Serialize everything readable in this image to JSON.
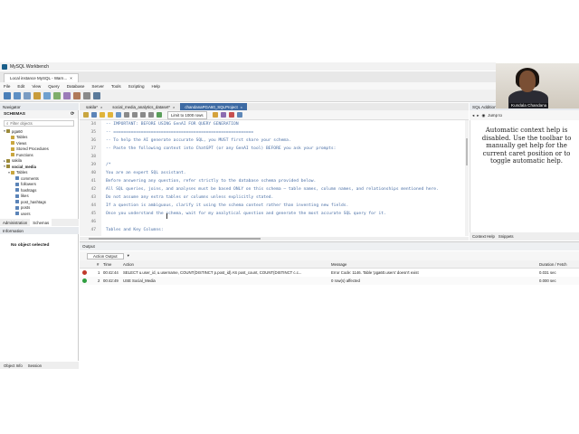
{
  "window": {
    "title": "MySQL Workbench"
  },
  "connection_tabs": [
    {
      "label": "Local instance MySQL - Warn..."
    }
  ],
  "menu": [
    "File",
    "Edit",
    "View",
    "Query",
    "Database",
    "Server",
    "Tools",
    "Scripting",
    "Help"
  ],
  "navigator": {
    "title": "Navigator",
    "section": "SCHEMAS",
    "filter_placeholder": "Filter objects",
    "tree": [
      {
        "label": "pga60",
        "level": 0,
        "expanded": true
      },
      {
        "label": "Tables",
        "level": 1
      },
      {
        "label": "Views",
        "level": 1
      },
      {
        "label": "Stored Procedures",
        "level": 1
      },
      {
        "label": "Functions",
        "level": 1
      },
      {
        "label": "sakila",
        "level": 0,
        "expanded": false
      },
      {
        "label": "social_media",
        "level": 0,
        "expanded": true,
        "bold": true
      },
      {
        "label": "Tables",
        "level": 1,
        "expanded": true
      },
      {
        "label": "comments",
        "level": 2
      },
      {
        "label": "followers",
        "level": 2
      },
      {
        "label": "hashtags",
        "level": 2
      },
      {
        "label": "likes",
        "level": 2
      },
      {
        "label": "post_hashtags",
        "level": 2
      },
      {
        "label": "posts",
        "level": 2
      },
      {
        "label": "users",
        "level": 2
      }
    ],
    "tabs": [
      "Administration",
      "Schemas"
    ]
  },
  "information": {
    "title": "Information",
    "empty": "No object selected",
    "tabs": [
      "Object Info",
      "Session"
    ]
  },
  "editor_tabs": [
    {
      "label": "sakila*",
      "active": false
    },
    {
      "label": "social_media_analytics_dataset*",
      "active": false
    },
    {
      "label": "chandanaPGA60_SQLProject",
      "active": true
    }
  ],
  "editor_toolbar": {
    "limit": "Limit to 1000 rows"
  },
  "editor": {
    "lines": [
      {
        "n": "34",
        "code": "-- IMPORTANT: BEFORE USING GenAI FOR QUERY GENERATION"
      },
      {
        "n": "35",
        "code": "-- ========================================================"
      },
      {
        "n": "36",
        "code": "-- To help the AI generate accurate SQL, you MUST first share your schema."
      },
      {
        "n": "37",
        "code": "-- Paste the following context into ChatGPT (or any GenAI tool) BEFORE you ask your prompts:"
      },
      {
        "n": "38",
        "code": ""
      },
      {
        "n": "39",
        "code": "/*"
      },
      {
        "n": "40",
        "code": "You are an expert SQL assistant."
      },
      {
        "n": "41",
        "code": "Before answering any question, refer strictly to the database schema provided below."
      },
      {
        "n": "42",
        "code": "All SQL queries, joins, and analyses must be based ONLY on this schema — table names, column names, and relationships mentioned here."
      },
      {
        "n": "43",
        "code": "Do not assume any extra tables or columns unless explicitly stated."
      },
      {
        "n": "44",
        "code": "If a question is ambiguous, clarify it using the schema context rather than inventing new fields."
      },
      {
        "n": "45",
        "code": "Once you understand the schema, wait for my analytical question and generate the most accurate SQL query for it."
      },
      {
        "n": "46",
        "code": ""
      },
      {
        "n": "47",
        "code": "Tables and Key Columns:"
      }
    ]
  },
  "sql_additions": {
    "title": "SQL Additions",
    "dropdown": "Jump to",
    "help_text": "Automatic context help is disabled. Use the toolbar to manually get help for the current caret position or to toggle automatic help.",
    "tabs": [
      "Context Help",
      "Snippets"
    ]
  },
  "output": {
    "title": "Output",
    "selector": "Action Output",
    "columns": [
      "#",
      "Time",
      "Action",
      "Message",
      "Duration / Fetch"
    ],
    "rows": [
      {
        "status": "error",
        "num": "1",
        "time": "00:42:44",
        "action": "SELECT    u.user_id,    u.username,    COUNT(DISTINCT p.post_id) AS post_count,    COUNT(DISTINCT c.c...",
        "message": "Error Code: 1146. Table 'pga60.users' doesn't exist",
        "duration": "0.031 sec"
      },
      {
        "status": "ok",
        "num": "2",
        "time": "00:42:49",
        "action": "USE Social_Media",
        "message": "0 row(s) affected",
        "duration": "0.000 sec"
      }
    ]
  },
  "webcam": {
    "name": "Kundala Chandana"
  },
  "colors": {
    "active_tab": "#3d6aa3",
    "error": "#c0392b",
    "ok": "#2e9e3f",
    "comment": "#4a6fa5"
  }
}
